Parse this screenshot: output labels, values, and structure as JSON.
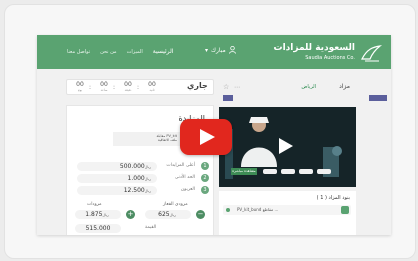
{
  "header": {
    "logo_ar": "السعودية للمزادات",
    "logo_en": "Saudia Auctions Co.",
    "nav": [
      "الرئيسية",
      "الميزات",
      "من نحن",
      "تواصل معنا"
    ],
    "user_name": "مبارك",
    "brand_color": "#5aa371"
  },
  "timer": {
    "status": "جاري",
    "units": [
      {
        "num": "00",
        "label": "يوم"
      },
      {
        "num": "00",
        "label": "ساعة"
      },
      {
        "num": "00",
        "label": "دقيقة"
      },
      {
        "num": "00",
        "label": "ثانية"
      }
    ]
  },
  "lot": {
    "name": "مزاد",
    "location": "الرياض"
  },
  "card": {
    "title": "المزايدة",
    "thumb_text_1": "مقابلة PV_kit",
    "thumb_text_2": "ملف الاتفاقية",
    "rows": [
      {
        "value": "500.000",
        "currency": "ريال",
        "label": "أعلى المزايدات",
        "icon": "1"
      },
      {
        "value": "1.000",
        "currency": "ريال",
        "label": "الحد الأدنى",
        "icon": "2"
      },
      {
        "value": "12.500",
        "currency": "ريال",
        "label": "العربون",
        "icon": "3"
      }
    ],
    "bid_heads": [
      "مزودات",
      "مزودي الفعاز"
    ],
    "bids": [
      {
        "value": "1.875",
        "currency": "ريال",
        "action": "+"
      },
      {
        "value": "625",
        "currency": "ريال",
        "action": "−"
      }
    ],
    "next_value": "515.000",
    "next_label": "القيمة"
  },
  "video": {
    "live_label": "مشاهدة مباشرة"
  },
  "lot_list": {
    "title": "بنود المزاد",
    "count": "( 1 )",
    "item_text": "PV_kit_bund مقاطع ..."
  }
}
